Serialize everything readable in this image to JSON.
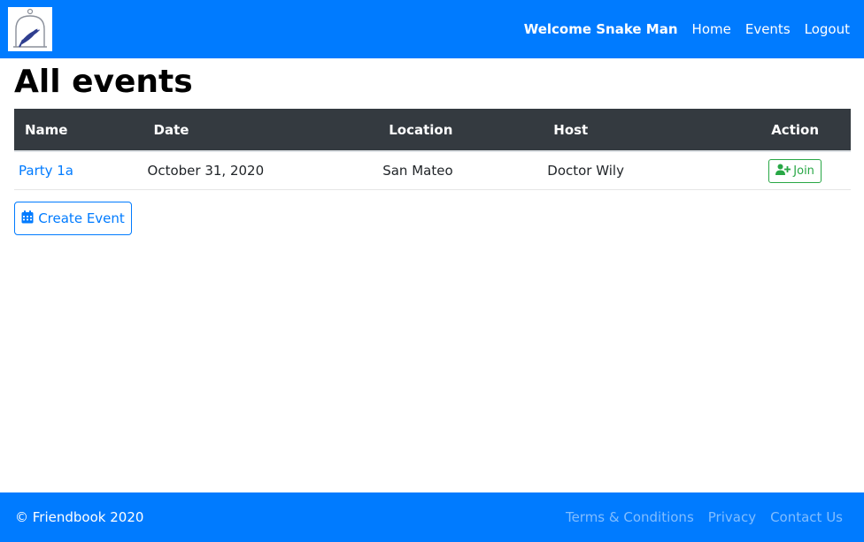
{
  "navbar": {
    "logo_icon": "birdcage-logo-icon",
    "welcome": "Welcome Snake Man",
    "links": [
      "Home",
      "Events",
      "Logout"
    ]
  },
  "page": {
    "title": "All events"
  },
  "table": {
    "headers": [
      "Name",
      "Date",
      "Location",
      "Host",
      "Action"
    ],
    "rows": [
      {
        "name": "Party 1a",
        "date": "October 31, 2020",
        "location": "San Mateo",
        "host": "Doctor Wily",
        "action": "Join"
      }
    ]
  },
  "create_button": {
    "label": "Create Event",
    "icon": "calendar-icon"
  },
  "footer": {
    "copyright": "© Friendbook 2020",
    "links": [
      "Terms & Conditions",
      "Privacy",
      "Contact Us"
    ]
  },
  "colors": {
    "primary": "#007bff",
    "table_header": "#343a40",
    "success": "#28a745",
    "footer_link": "#80bdff"
  }
}
